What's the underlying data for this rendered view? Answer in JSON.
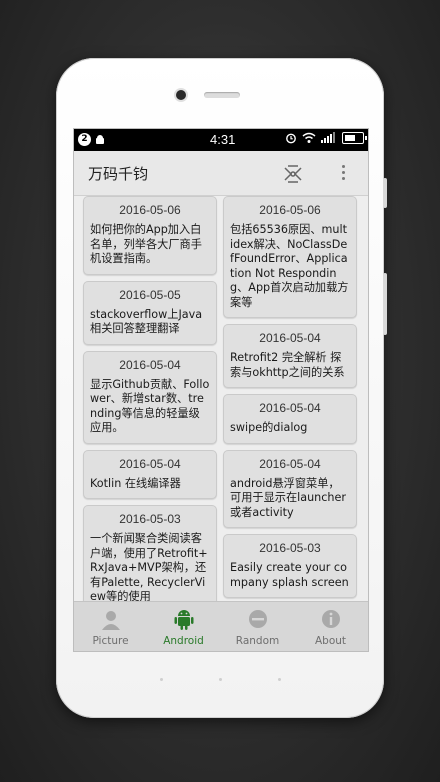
{
  "status_bar": {
    "notification_count": "2",
    "time": "4:31"
  },
  "toolbar": {
    "title": "万码千钧"
  },
  "cards_left": [
    {
      "date": "2016-05-06",
      "desc": "如何把你的App加入白名单，列举各大厂商手机设置指南。"
    },
    {
      "date": "2016-05-05",
      "desc": "stackoverflow上Java相关回答整理翻译"
    },
    {
      "date": "2016-05-04",
      "desc": "显示Github贡献、Follower、新增star数、trending等信息的轻量级应用。"
    },
    {
      "date": "2016-05-04",
      "desc": "Kotlin 在线编译器"
    },
    {
      "date": "2016-05-03",
      "desc": "一个新闻聚合类阅读客户端，使用了Retrofit+RxJava+MVP架构，还有Palette, RecyclerView等的使用"
    }
  ],
  "cards_right": [
    {
      "date": "2016-05-06",
      "desc": "包括65536原因、multidex解决、NoClassDefFoundError、Application Not Responding、App首次启动加载方案等"
    },
    {
      "date": "2016-05-04",
      "desc": "Retrofit2 完全解析 探索与okhttp之间的关系"
    },
    {
      "date": "2016-05-04",
      "desc": "swipe的dialog"
    },
    {
      "date": "2016-05-04",
      "desc": "android悬浮窗菜单，可用于显示在launcher或者activity"
    },
    {
      "date": "2016-05-03",
      "desc": "Easily create your company splash screen"
    }
  ],
  "bottom_nav": [
    {
      "label": "Picture",
      "icon": "picture-icon",
      "active": false
    },
    {
      "label": "Android",
      "icon": "android-icon",
      "active": true
    },
    {
      "label": "Random",
      "icon": "random-icon",
      "active": false
    },
    {
      "label": "About",
      "icon": "info-icon",
      "active": false
    }
  ],
  "colors": {
    "active_tab": "#2a7a2a",
    "inactive_tab": "#6e6e6e",
    "card_bg": "#e0e0e0"
  }
}
